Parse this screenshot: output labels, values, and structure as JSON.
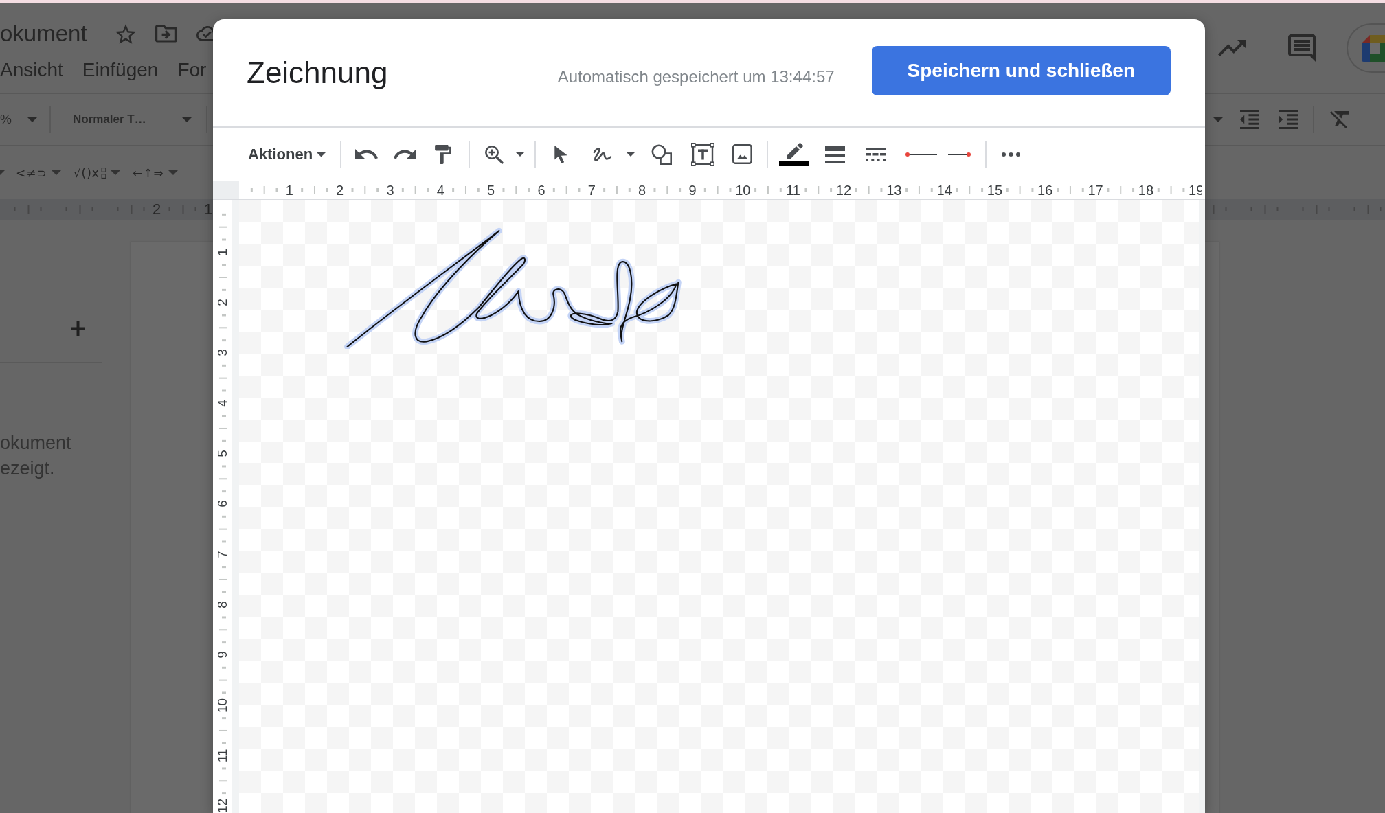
{
  "document": {
    "title": "okument",
    "menu": [
      "Ansicht",
      "Einfügen",
      "For"
    ],
    "toolbar": {
      "zoom": "%",
      "paragraph_style": "Normaler T…"
    },
    "equation_toolbar": [
      "<≠⊃",
      "√()x",
      "←↑⇒"
    ],
    "ruler": [
      "2",
      "1"
    ],
    "outline_panel": {
      "lines": [
        "okument",
        "ezeigt."
      ]
    }
  },
  "dialog": {
    "title": "Zeichnung",
    "autosave_status": "Automatisch gespeichert um 13:44:57",
    "save_button": "Speichern und schließen",
    "toolbar": {
      "actions_menu": "Aktionen"
    },
    "horizontal_ruler": [
      "1",
      "2",
      "3",
      "4",
      "5",
      "6",
      "7",
      "8",
      "9",
      "10",
      "11",
      "12",
      "13",
      "14",
      "15",
      "16",
      "17",
      "18",
      "19"
    ],
    "vertical_ruler": [
      "1",
      "2",
      "3",
      "4",
      "5",
      "6",
      "7",
      "8",
      "9",
      "10",
      "11",
      "12"
    ]
  }
}
